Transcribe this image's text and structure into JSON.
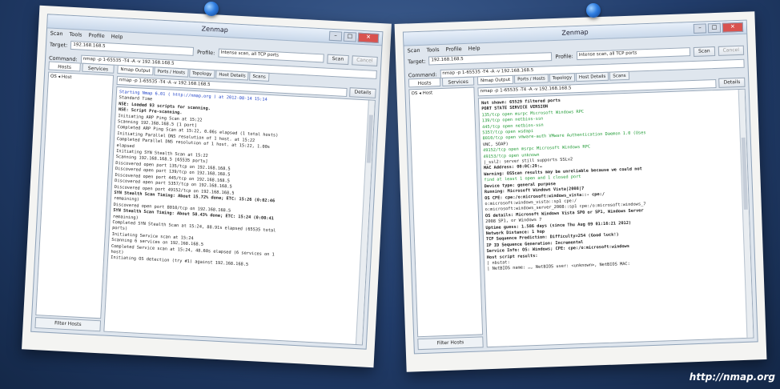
{
  "left_window": {
    "title": "Zenmap",
    "menu": [
      "Scan",
      "Tools",
      "Profile",
      "Help"
    ],
    "target_label": "Target:",
    "target_value": "192.168.168.5",
    "profile_label": "Profile:",
    "profile_value": "Intense scan, all TCP ports",
    "scan_button": "Scan",
    "cancel_button": "Cancel",
    "command_label": "Command:",
    "command_value": "nmap -p 1-65535 -T4 -A -v 192.168.168.5",
    "side_tabs": [
      "Hosts",
      "Services"
    ],
    "side_header": "OS ◂ Host",
    "filter_button": "Filter Hosts",
    "main_tabs": [
      "Nmap Output",
      "Ports / Hosts",
      "Topology",
      "Host Details",
      "Scans"
    ],
    "output_command": "nmap -p 1-65535 -T4 -A -v 192.168.168.5",
    "details_button": "Details",
    "output_lines": [
      "Starting Nmap 6.01 ( http://nmap.org ) at 2012-08-14 15:14",
      "Standard Time",
      "NSE: Loaded 93 scripts for scanning.",
      "NSE: Script Pre-scanning.",
      "Initiating ARP Ping Scan at 15:22",
      "Scanning 192.168.168.5 [1 port]",
      "Completed ARP Ping Scan at 15:22, 0.06s elapsed (1 total hosts)",
      "Initiating Parallel DNS resolution of 1 host. at 15:22",
      "Completed Parallel DNS resolution of 1 host. at 15:22, 1.00s",
      "elapsed",
      "Initiating SYN Stealth Scan at 15:22",
      "Scanning 192.168.168.5 [65535 ports]",
      "Discovered open port 135/tcp on 192.168.168.5",
      "Discovered open port 139/tcp on 192.168.168.5",
      "Discovered open port 445/tcp on 192.168.168.5",
      "Discovered open port 5357/tcp on 192.168.168.5",
      "Discovered open port 49152/tcp on 192.168.168.5",
      "SYN Stealth Scan Timing: About 15.72% done; ETC: 15:26 (0:02:46",
      "remaining)",
      "Discovered open port 8010/tcp on 192.168.168.5",
      "SYN Stealth Scan Timing: About 50.43% done; ETC: 15:24 (0:00:41",
      "remaining)",
      "Completed SYN Stealth Scan at 15:24, 88.91s elapsed (65535 total",
      "ports)",
      "Initiating Service scan at 15:24",
      "Scanning 6 services on 192.168.168.5",
      "Completed Service scan at 15:24, 48.60s elapsed (6 services on 1",
      "host)",
      "Initiating OS detection (try #1) against 192.168.168.5"
    ]
  },
  "right_window": {
    "title": "Zenmap",
    "menu": [
      "Scan",
      "Tools",
      "Profile",
      "Help"
    ],
    "target_label": "Target:",
    "target_value": "192.168.168.5",
    "profile_label": "Profile:",
    "profile_value": "Intense scan, all TCP ports",
    "scan_button": "Scan",
    "cancel_button": "Cancel",
    "command_label": "Command:",
    "command_value": "nmap -p 1-65535 -T4 -A -v 192.168.168.5",
    "side_tabs": [
      "Hosts",
      "Services"
    ],
    "side_header": "OS ◂ Host",
    "filter_button": "Filter Hosts",
    "main_tabs": [
      "Nmap Output",
      "Ports / Hosts",
      "Topology",
      "Host Details",
      "Scans"
    ],
    "output_command": "nmap -p 1-65535 -T4 -A -v 192.168.168.5",
    "details_button": "Details",
    "output_lines": [
      "Not shown: 65529 filtered ports",
      "PORT      STATE SERVICE       VERSION",
      "135/tcp   open  msrpc         Microsoft Windows RPC",
      "139/tcp   open  netbios-ssn",
      "445/tcp   open  netbios-ssn",
      "5357/tcp  open  wsdapi",
      "8010/tcp  open  vmware-auth   VMware Authentication Daemon 1.0 (Uses",
      "VNC, SOAP)",
      "49152/tcp open  msrpc         Microsoft Windows RPC",
      "49153/tcp open  unknown",
      "|_ssl2: server still supports SSLv2",
      "MAC Address: 00:0C:29:…",
      "Warning: OSScan results may be unreliable because we could not",
      "find at least 1 open and 1 closed port",
      "Device type: general purpose",
      "Running: Microsoft Windows Vista|2008|7",
      "OS CPE: cpe:/o:microsoft:windows_vista::- cpe:/",
      "o:microsoft:windows_vista::sp1 cpe:/",
      "o:microsoft:windows_server_2008::sp1 cpe:/o:microsoft:windows_7",
      "OS details: Microsoft Windows Vista SP0 or SP1, Windows Server",
      "2008 SP1, or Windows 7",
      "Uptime guess: 1.586 days (since Thu Aug 09 01:16:21 2012)",
      "Network Distance: 1 hop",
      "TCP Sequence Prediction: Difficulty=254 (Good luck!)",
      "IP ID Sequence Generation: Incremental",
      "Service Info: OS: Windows; CPE: cpe:/o:microsoft:windows",
      "",
      "Host script results:",
      "| nbstat:",
      "|   NetBIOS name: …, NetBIOS user: <unknown>, NetBIOS MAC:"
    ]
  },
  "footer_url": "http://nmap.org"
}
